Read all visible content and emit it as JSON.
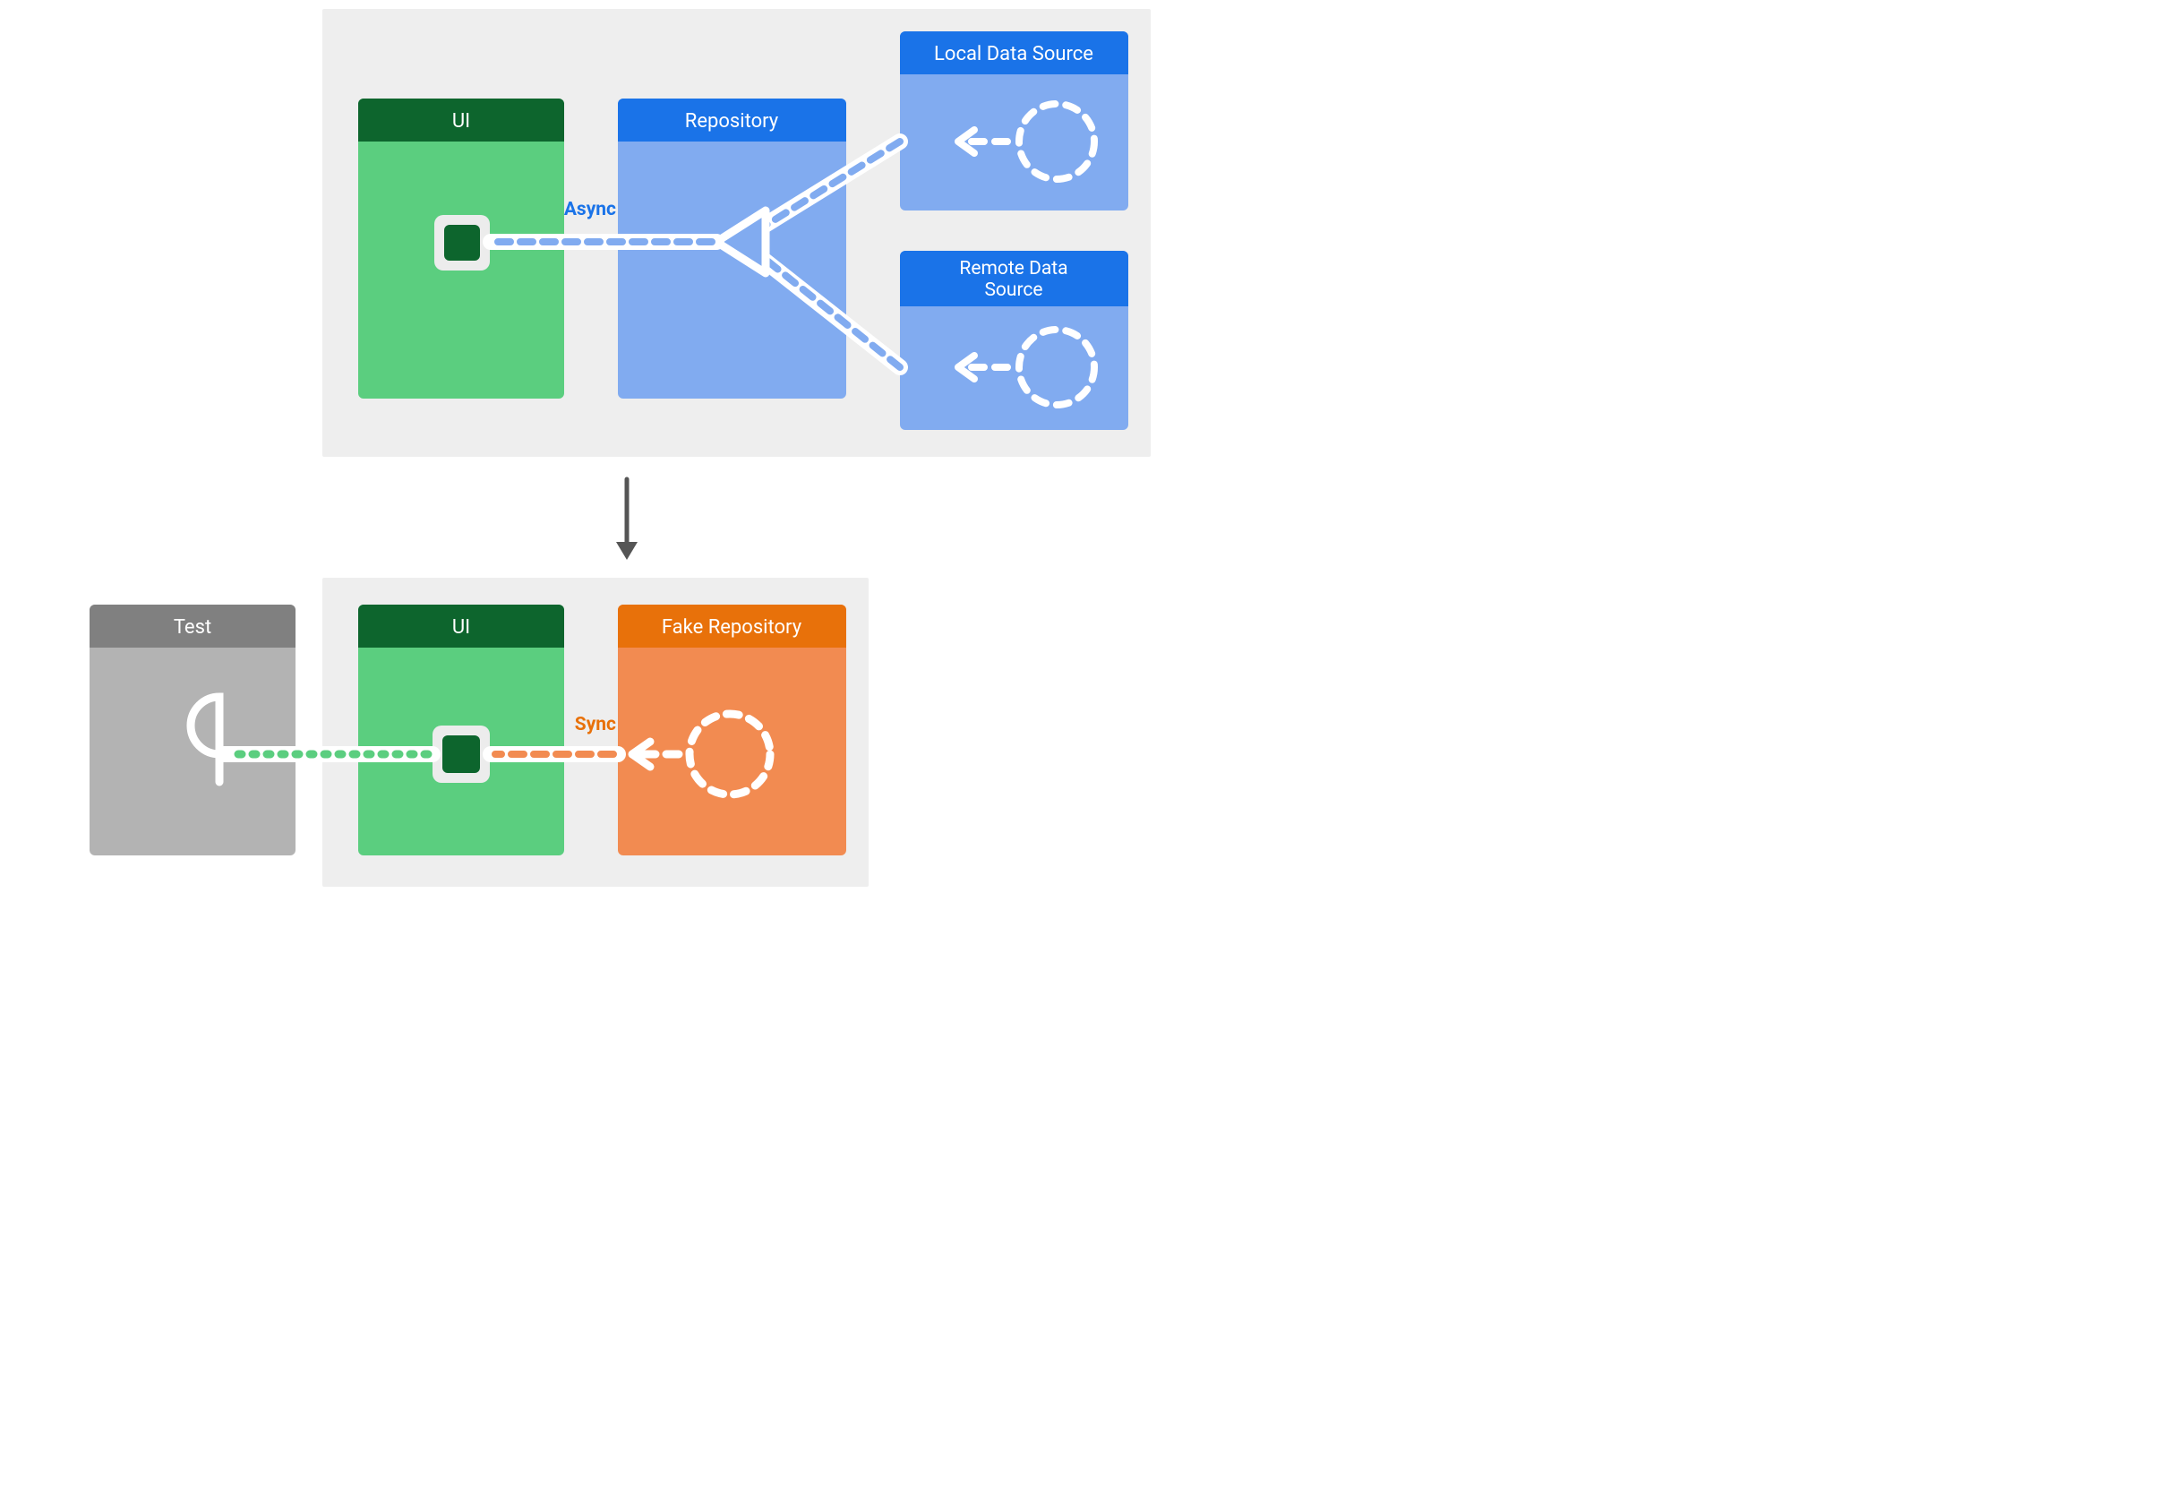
{
  "labels": {
    "ui1": "UI",
    "repository": "Repository",
    "local_ds": "Local Data Source",
    "remote_ds_line1": "Remote Data",
    "remote_ds_line2": "Source",
    "async": "Async",
    "test": "Test",
    "ui2": "UI",
    "fake_repo": "Fake Repository",
    "sync": "Sync"
  },
  "colors": {
    "panel_bg": "#eeeeee",
    "green_header": "#0d652d",
    "green_body": "#5bce7f",
    "blue_header": "#1a73e8",
    "blue_body": "#81abf0",
    "orange_header": "#e8710a",
    "orange_body": "#f28b51",
    "gray_header": "#808080",
    "gray_body": "#b3b3b3",
    "white": "#ffffff",
    "text_async": "#1a73e8",
    "text_sync": "#e8710a",
    "arrow_down": "#555555"
  },
  "diagram": {
    "description": "Architecture comparison: production UI connects to a Repository that asynchronously aggregates a Local Data Source and a Remote Data Source; in tests, a Test harness drives the UI against a synchronous Fake Repository.",
    "top": {
      "components": [
        "UI",
        "Repository",
        "Local Data Source",
        "Remote Data Source"
      ],
      "flow_mode": "Async",
      "edges": [
        {
          "from": "Local Data Source",
          "to": "Repository",
          "style": "dashed"
        },
        {
          "from": "Remote Data Source",
          "to": "Repository",
          "style": "dashed"
        },
        {
          "from": "Repository",
          "to": "UI",
          "style": "dashed",
          "label": "Async"
        }
      ]
    },
    "transition": "top replaced by bottom for testing",
    "bottom": {
      "components": [
        "Test",
        "UI",
        "Fake Repository"
      ],
      "flow_mode": "Sync",
      "edges": [
        {
          "from": "Fake Repository",
          "to": "UI",
          "style": "dashed",
          "label": "Sync"
        },
        {
          "from": "UI",
          "to": "Test",
          "style": "dotted"
        }
      ]
    }
  }
}
